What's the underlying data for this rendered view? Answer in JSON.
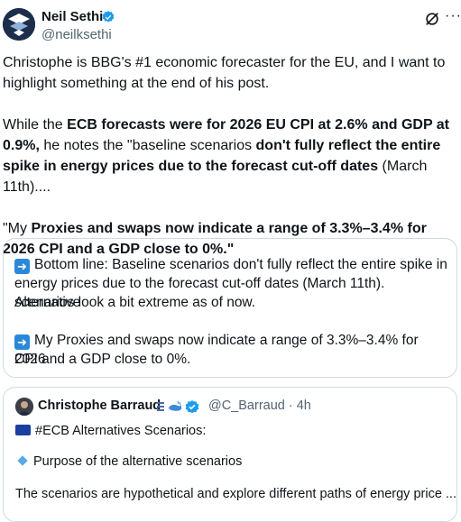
{
  "author": {
    "name": "Neil Sethi",
    "handle": "@neilksethi"
  },
  "tweet": {
    "p1": "Christophe is BBG's #1 economic forecaster for the EU, and I want to highlight something at the end of his post.",
    "p2_a": "While the ",
    "p2_b": "ECB forecasts were for 2026 EU CPI at 2.6% and GDP at 0.9%,",
    "p2_c": " he notes the \"baseline scenarios ",
    "p2_d": "don't fully reflect the entire spike in energy prices due to the forecast cut-off dates",
    "p2_e": " (March 11th)....",
    "p3_a": "\"My ",
    "p3_b": "Proxies and swaps now indicate a range of 3.3%–3.4% for 2026 CPI and a GDP close to 0%.\""
  },
  "quote1": {
    "line1": "Bottom line: Baseline scenarios don't fully reflect the entire spike in",
    "line2": "energy prices due to the forecast cut-off dates (March 11th). Alternative",
    "line3": "scenarios look a bit extreme as of now.",
    "line4": "My Proxies and swaps now indicate a range of 3.3%–3.4% for 2026",
    "line5": "CPI and a GDP close to 0%."
  },
  "quote2": {
    "name": "Christophe Barraud",
    "handle_time": "@C_Barraud · 4h",
    "line1": "#ECB Alternatives Scenarios:",
    "line2": "Purpose of the alternative scenarios",
    "line3": "The scenarios are hypothetical and explore different paths of energy price ..."
  },
  "colors": {
    "verified": "#1d9bf0",
    "secondary_text": "#536471",
    "border": "#cfd9de"
  }
}
